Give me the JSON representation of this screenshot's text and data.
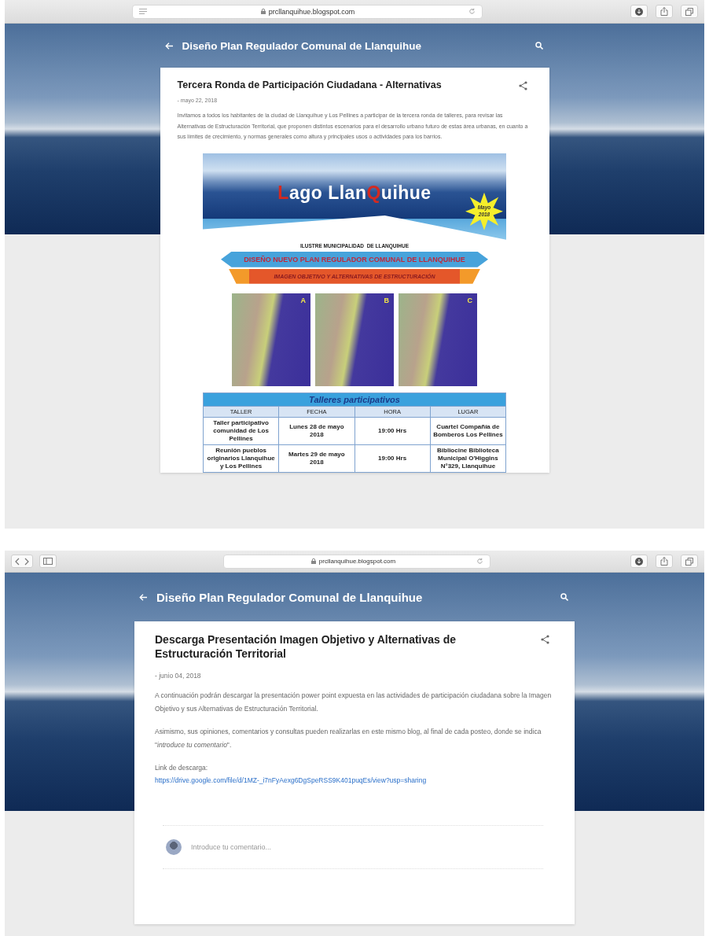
{
  "screens": [
    {
      "kind": "image-post",
      "browser": {
        "url": "prcllanquihue.blogspot.com"
      },
      "blog_title": "Diseño Plan Regulador Comunal de Llanquihue",
      "post": {
        "title": "Tercera Ronda de Participación Ciudadana - Alternativas",
        "date": "- mayo 22, 2018",
        "paragraphs": [
          "Invitamos a todos los habitantes de la ciudad de Llanquihue y Los Pellines a participar de la tercera ronda de talleres, para revisar las Alternativas de Estructuración Territorial, que proponen distintos escenarios para el desarrollo urbano futuro de estas área urbanas, en cuanto a sus límites de crecimiento, y normas generales como altura y principales usos o actividades para los barrios."
        ],
        "flyer": {
          "logo": [
            {
              "text": "L",
              "accent": true
            },
            {
              "text": "ago Llan",
              "accent": false
            },
            {
              "text": "Q",
              "accent": true
            },
            {
              "text": "uihue",
              "accent": false
            }
          ],
          "badge": "Mayo 2018",
          "issuer": "ILUSTRE MUNICIPALIDAD  DE LLANQUIHUE",
          "banner": "DISEÑO NUEVO PLAN REGULADOR COMUNAL DE LLANQUIHUE",
          "subtitle": "IMAGEN OBJETIVO Y ALTERNATIVAS DE ESTRUCTURACIÓN",
          "maps": [
            {
              "label": "A"
            },
            {
              "label": "B"
            },
            {
              "label": "C"
            }
          ],
          "table": {
            "title": "Talleres participativos",
            "columns": [
              "TALLER",
              "FECHA",
              "HORA",
              "LUGAR"
            ],
            "rows": [
              [
                "Taller participativo comunidad de Los Pellines",
                "Lunes 28 de mayo 2018",
                "19:00 Hrs",
                "Cuartel Compañía de Bomberos Los Pellines"
              ],
              [
                "Reunión pueblos originarios Llanquihue y Los Pellines",
                "Martes 29 de mayo 2018",
                "19:00 Hrs",
                "Bibliocine Biblioteca Municipal O'Higgins N°329, Llanquihue"
              ]
            ]
          }
        }
      }
    },
    {
      "kind": "text-post",
      "browser": {
        "url": "prcllanquihue.blogspot.com"
      },
      "blog_title": "Diseño Plan Regulador Comunal de Llanquihue",
      "post": {
        "title": "Descarga Presentación Imagen Objetivo y Alternativas de Estructuración Territorial",
        "date": "- junio 04, 2018",
        "paragraphs": [
          "A continuación podrán descargar la presentación power point expuesta en las actividades de participación ciudadana sobre la Imagen Objetivo y sus Alternativas de Estructuración Territorial.",
          "Asimismo, sus opiniones, comentarios y consultas pueden realizarlas en este mismo blog, al final de cada posteo, donde se indica \"*introduce tu comentario*\"."
        ],
        "download_label": "Link de descarga:",
        "link": "https://drive.google.com/file/d/1MZ-_i7nFyAexg6DgSpeRSS9K401puqEs/view?usp=sharing",
        "comment_box": {
          "placeholder": "Introduce tu comentario..."
        }
      }
    }
  ]
}
